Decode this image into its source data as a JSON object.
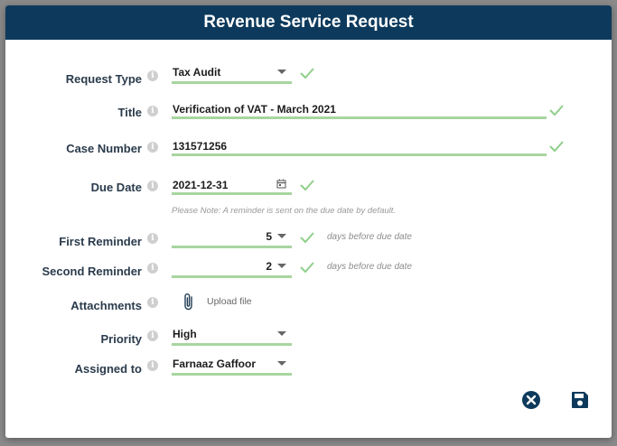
{
  "dialog": {
    "title": "Revenue Service Request"
  },
  "form": {
    "request_type": {
      "label": "Request Type",
      "value": "Tax Audit"
    },
    "title": {
      "label": "Title",
      "value": "Verification of VAT - March 2021"
    },
    "case_number": {
      "label": "Case Number",
      "value": "131571256"
    },
    "due_date": {
      "label": "Due Date",
      "value": "2021-12-31",
      "note": "Please Note: A reminder is sent on the due date by default."
    },
    "first_reminder": {
      "label": "First Reminder",
      "value": "5",
      "suffix": "days before due date"
    },
    "second_reminder": {
      "label": "Second Reminder",
      "value": "2",
      "suffix": "days before due date"
    },
    "attachments": {
      "label": "Attachments",
      "upload_label": "Upload file"
    },
    "priority": {
      "label": "Priority",
      "value": "High"
    },
    "assigned_to": {
      "label": "Assigned to",
      "value": "Farnaaz Gaffoor"
    }
  },
  "info_glyph": "i",
  "icons": {
    "info": "info-icon",
    "check": "checkmark-icon",
    "dropdown": "chevron-down-icon",
    "calendar": "calendar-icon",
    "attach": "paperclip-icon",
    "cancel": "close-circle-icon",
    "save": "floppy-disk-icon"
  },
  "colors": {
    "header_bg": "#0d3a5c",
    "valid_underline": "#a8d5a0",
    "check": "#8fcf8a",
    "action_icon": "#0d3a5c"
  }
}
